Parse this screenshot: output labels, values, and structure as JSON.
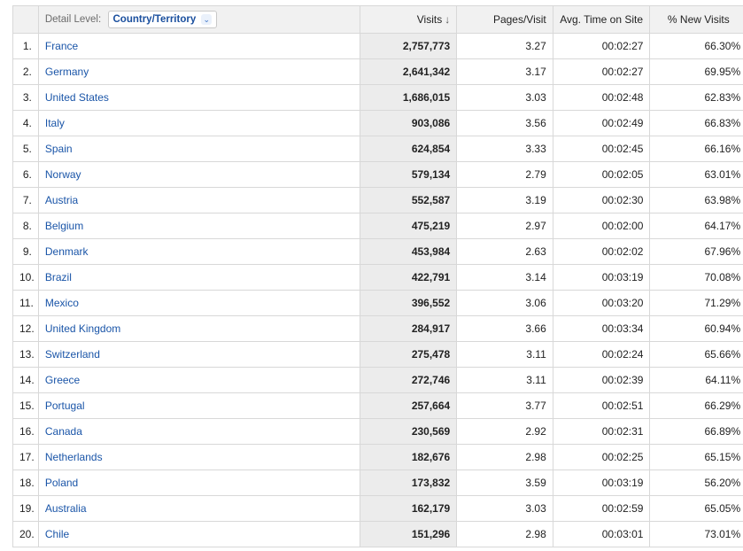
{
  "header": {
    "detail_label": "Detail Level:",
    "dimension_selected": "Country/Territory",
    "columns": [
      "Visits",
      "Pages/Visit",
      "Avg. Time on Site",
      "% New Visits"
    ],
    "sort_indicator": "↓",
    "dropdown_icon": "chevron-down-icon"
  },
  "rows": [
    {
      "rank": "1.",
      "country": "France",
      "visits": "2,757,773",
      "pages_per_visit": "3.27",
      "avg_time": "00:02:27",
      "new_visits": "66.30%"
    },
    {
      "rank": "2.",
      "country": "Germany",
      "visits": "2,641,342",
      "pages_per_visit": "3.17",
      "avg_time": "00:02:27",
      "new_visits": "69.95%"
    },
    {
      "rank": "3.",
      "country": "United States",
      "visits": "1,686,015",
      "pages_per_visit": "3.03",
      "avg_time": "00:02:48",
      "new_visits": "62.83%"
    },
    {
      "rank": "4.",
      "country": "Italy",
      "visits": "903,086",
      "pages_per_visit": "3.56",
      "avg_time": "00:02:49",
      "new_visits": "66.83%"
    },
    {
      "rank": "5.",
      "country": "Spain",
      "visits": "624,854",
      "pages_per_visit": "3.33",
      "avg_time": "00:02:45",
      "new_visits": "66.16%"
    },
    {
      "rank": "6.",
      "country": "Norway",
      "visits": "579,134",
      "pages_per_visit": "2.79",
      "avg_time": "00:02:05",
      "new_visits": "63.01%"
    },
    {
      "rank": "7.",
      "country": "Austria",
      "visits": "552,587",
      "pages_per_visit": "3.19",
      "avg_time": "00:02:30",
      "new_visits": "63.98%"
    },
    {
      "rank": "8.",
      "country": "Belgium",
      "visits": "475,219",
      "pages_per_visit": "2.97",
      "avg_time": "00:02:00",
      "new_visits": "64.17%"
    },
    {
      "rank": "9.",
      "country": "Denmark",
      "visits": "453,984",
      "pages_per_visit": "2.63",
      "avg_time": "00:02:02",
      "new_visits": "67.96%"
    },
    {
      "rank": "10.",
      "country": "Brazil",
      "visits": "422,791",
      "pages_per_visit": "3.14",
      "avg_time": "00:03:19",
      "new_visits": "70.08%"
    },
    {
      "rank": "11.",
      "country": "Mexico",
      "visits": "396,552",
      "pages_per_visit": "3.06",
      "avg_time": "00:03:20",
      "new_visits": "71.29%"
    },
    {
      "rank": "12.",
      "country": "United Kingdom",
      "visits": "284,917",
      "pages_per_visit": "3.66",
      "avg_time": "00:03:34",
      "new_visits": "60.94%"
    },
    {
      "rank": "13.",
      "country": "Switzerland",
      "visits": "275,478",
      "pages_per_visit": "3.11",
      "avg_time": "00:02:24",
      "new_visits": "65.66%"
    },
    {
      "rank": "14.",
      "country": "Greece",
      "visits": "272,746",
      "pages_per_visit": "3.11",
      "avg_time": "00:02:39",
      "new_visits": "64.11%"
    },
    {
      "rank": "15.",
      "country": "Portugal",
      "visits": "257,664",
      "pages_per_visit": "3.77",
      "avg_time": "00:02:51",
      "new_visits": "66.29%"
    },
    {
      "rank": "16.",
      "country": "Canada",
      "visits": "230,569",
      "pages_per_visit": "2.92",
      "avg_time": "00:02:31",
      "new_visits": "66.89%"
    },
    {
      "rank": "17.",
      "country": "Netherlands",
      "visits": "182,676",
      "pages_per_visit": "2.98",
      "avg_time": "00:02:25",
      "new_visits": "65.15%"
    },
    {
      "rank": "18.",
      "country": "Poland",
      "visits": "173,832",
      "pages_per_visit": "3.59",
      "avg_time": "00:03:19",
      "new_visits": "56.20%"
    },
    {
      "rank": "19.",
      "country": "Australia",
      "visits": "162,179",
      "pages_per_visit": "3.03",
      "avg_time": "00:02:59",
      "new_visits": "65.05%"
    },
    {
      "rank": "20.",
      "country": "Chile",
      "visits": "151,296",
      "pages_per_visit": "2.98",
      "avg_time": "00:03:01",
      "new_visits": "73.01%"
    }
  ],
  "colors": {
    "link": "#1a55a8",
    "selector_text": "#1a4f9e",
    "sorted_header_bg": "#d8d8d8",
    "sorted_column_bg": "#ececec",
    "header_bg": "#f1f1f1",
    "border": "#d8d8d8"
  }
}
